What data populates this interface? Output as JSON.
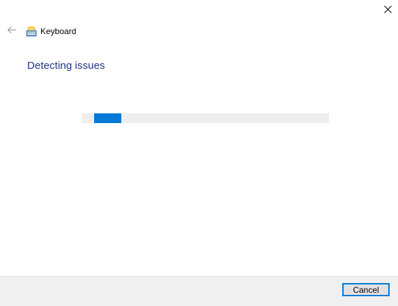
{
  "window": {
    "close_icon": "close-icon"
  },
  "header": {
    "back_icon": "back-arrow-icon",
    "app_icon": "keyboard-troubleshooter-icon",
    "title": "Keyboard"
  },
  "main": {
    "heading": "Detecting issues",
    "progress": {
      "indeterminate": true,
      "fill_start_fraction": 0.05,
      "fill_end_fraction": 0.16
    }
  },
  "footer": {
    "cancel_label": "Cancel"
  },
  "colors": {
    "heading": "#1e3287",
    "progress_fill": "#0078d7",
    "progress_track": "#eeeeee",
    "footer_bg": "#f0f0f0",
    "focus_border": "#0078d7"
  }
}
